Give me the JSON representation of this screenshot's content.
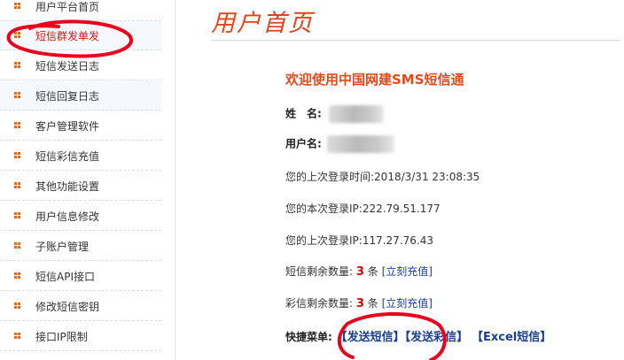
{
  "sidebar": {
    "items": [
      {
        "label": "用户平台首页"
      },
      {
        "label": "短信群发单发"
      },
      {
        "label": "短信发送日志"
      },
      {
        "label": "短信回复日志"
      },
      {
        "label": "客户管理软件"
      },
      {
        "label": "短信彩信充值"
      },
      {
        "label": "其他功能设置"
      },
      {
        "label": "用户信息修改"
      },
      {
        "label": "子账户管理"
      },
      {
        "label": "短信API接口"
      },
      {
        "label": "修改短信密钥"
      },
      {
        "label": "接口IP限制"
      }
    ]
  },
  "main": {
    "title": "用户首页",
    "welcome": "欢迎使用中国网建SMS短信通",
    "name_label": "姓　名:",
    "username_label": "用户名:",
    "last_login_time_label": "您的上次登录时间:",
    "last_login_time": "2018/3/31 23:08:35",
    "this_login_ip_label": "您的本次登录IP:",
    "this_login_ip": "222.79.51.177",
    "last_login_ip_label": "您的上次登录IP:",
    "last_login_ip": "117.27.76.43",
    "sms_remaining_label": "短信剩余数量:",
    "sms_remaining": "3",
    "mms_remaining_label": "彩信剩余数量:",
    "mms_remaining": "3",
    "unit": "条",
    "recharge_link": "[立刻充值]",
    "quick_menu_label": "快捷菜单:",
    "quick_links": [
      "【发送短信】",
      "【发送彩信】",
      "【Excel短信】"
    ]
  },
  "colors": {
    "title": "#e0441f",
    "welcome": "#e24a1c",
    "link": "#1a3f8f",
    "count": "#d40000",
    "annotation": "#e8001c",
    "nav_icon": "#e06a1c"
  }
}
